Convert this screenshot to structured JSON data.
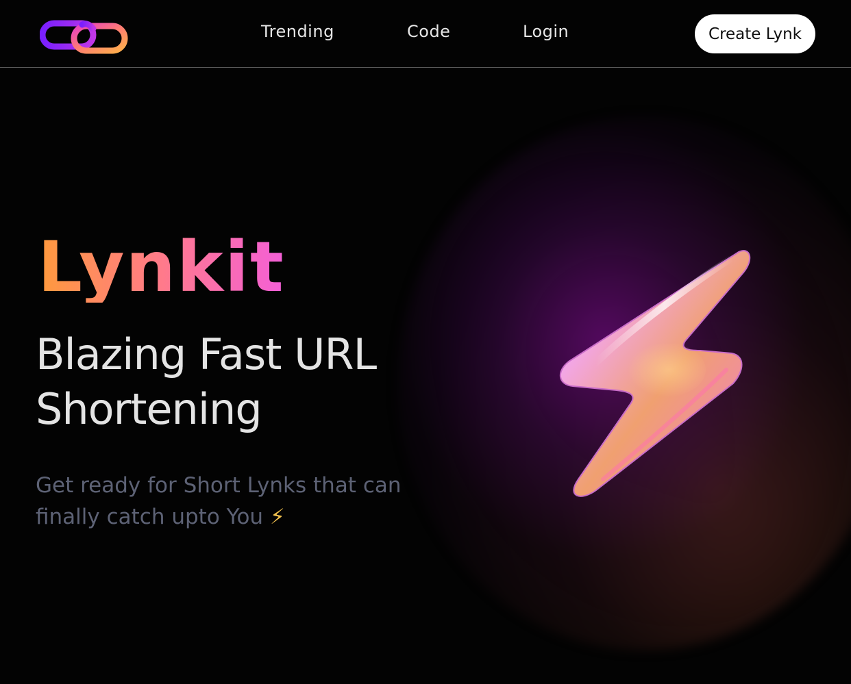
{
  "nav": {
    "logo_icon": "chain-link-icon",
    "links": [
      {
        "label": "Trending"
      },
      {
        "label": "Code"
      },
      {
        "label": "Login"
      }
    ],
    "cta_label": "Create Lynk"
  },
  "hero": {
    "brand": "Lynkit",
    "headline": "Blazing Fast URL Shortening",
    "subtext": "Get ready for Short Lynks that can finally catch upto You",
    "subtext_emoji": "⚡",
    "illustration_icon": "lightning-bolt-icon"
  },
  "colors": {
    "background": "#030303",
    "brand_gradient_start": "#ff9a3c",
    "brand_gradient_end": "#f45fd8",
    "headline": "#e4e4e4",
    "subtext": "#5d6275",
    "cta_bg": "#ffffff"
  }
}
